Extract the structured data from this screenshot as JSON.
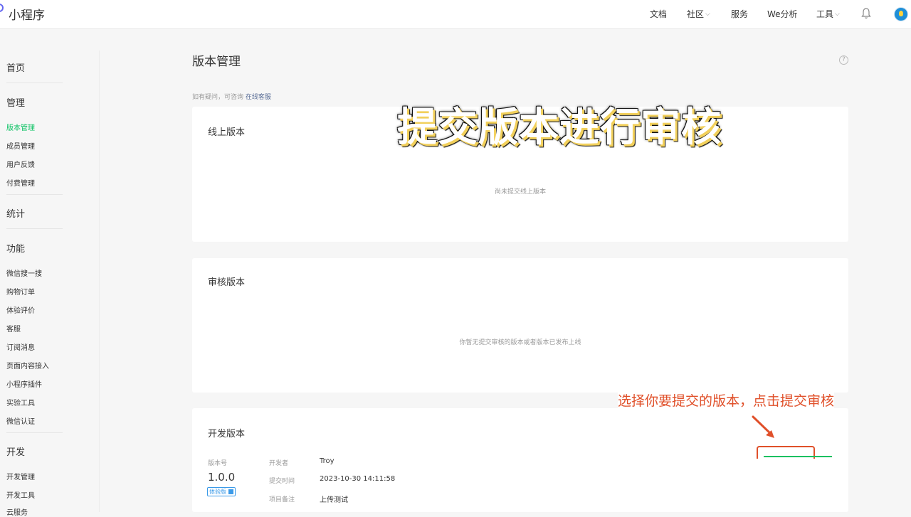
{
  "app": {
    "title": "小程序"
  },
  "topnav": [
    {
      "label": "文档",
      "dropdown": false
    },
    {
      "label": "社区",
      "dropdown": true
    },
    {
      "label": "服务",
      "dropdown": false
    },
    {
      "label": "We分析",
      "dropdown": false
    },
    {
      "label": "工具",
      "dropdown": true
    }
  ],
  "icons": {
    "bell": "bell-icon",
    "avatar": "avatar",
    "help": "help-icon",
    "logo": "logo-icon"
  },
  "sidebar": {
    "home": "首页",
    "manage": {
      "title": "管理",
      "items": [
        "版本管理",
        "成员管理",
        "用户反馈",
        "付费管理"
      ]
    },
    "stats": "统计",
    "features": {
      "title": "功能",
      "items": [
        "微信搜一搜",
        "购物订单",
        "体验评价",
        "客服",
        "订阅消息",
        "页面内容接入",
        "小程序插件",
        "实验工具",
        "微信认证"
      ]
    },
    "develop": {
      "title": "开发",
      "items": [
        "开发管理",
        "开发工具",
        "云服务"
      ]
    },
    "active_item": "版本管理"
  },
  "main": {
    "title": "版本管理",
    "hint": "如有疑问，可咨询",
    "hint_link": "在线客服",
    "online": {
      "title": "线上版本",
      "empty": "尚未提交线上版本"
    },
    "review": {
      "title": "审核版本",
      "empty": "你暂无提交审核的版本或者版本已发布上线"
    },
    "dev": {
      "title": "开发版本",
      "version_label": "版本号",
      "version": "1.0.0",
      "tag": "体验版",
      "developer_label": "开发者",
      "developer": "Troy",
      "submit_time_label": "提交时间",
      "submit_time": "2023-10-30 14:11:58",
      "remark_label": "项目备注",
      "remark": "上传测试"
    }
  },
  "overlay": {
    "caption": "提交版本进行审核",
    "instruction": "选择你要提交的版本，点击提交审核"
  },
  "colors": {
    "accent": "#07c160",
    "link": "#576b95",
    "annotation": "#e0502a"
  }
}
